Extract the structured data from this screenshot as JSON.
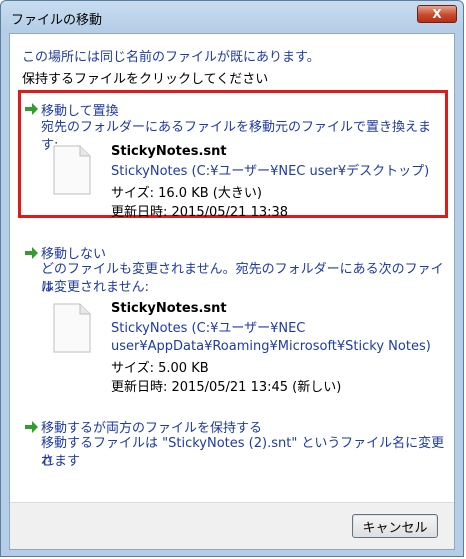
{
  "window": {
    "title": "ファイルの移動",
    "close_label": "X"
  },
  "intro": {
    "line1": "この場所には同じ名前のファイルが既にあります。",
    "line2": "保持するファイルをクリックしてください"
  },
  "options": {
    "replace": {
      "title": "移動して置換",
      "description": "宛先のフォルダーにあるファイルを移動元のファイルで置き換えます:",
      "file": {
        "name": "StickyNotes.snt",
        "path_lines": [
          "StickyNotes (C:¥ユーザー¥NEC user¥デスクトップ)"
        ],
        "size": "サイズ: 16.0 KB (大きい)",
        "modified": "更新日時: 2015/05/21 13:38"
      }
    },
    "dont_move": {
      "title": "移動しない",
      "description_lines": [
        "どのファイルも変更されません。宛先のフォルダーにある次のファイル",
        "は変更されません:"
      ],
      "file": {
        "name": "StickyNotes.snt",
        "path_lines": [
          "StickyNotes (C:¥ユーザー¥NEC",
          "user¥AppData¥Roaming¥Microsoft¥Sticky Notes)"
        ],
        "size": "サイズ: 5.00 KB",
        "modified": "更新日時: 2015/05/21 13:45 (新しい)"
      }
    },
    "keep_both": {
      "title": "移動するが両方のファイルを保持する",
      "description_lines": [
        "移動するファイルは \"StickyNotes (2).snt\" というファイル名に変更さ",
        "れます"
      ]
    }
  },
  "footer": {
    "cancel_label": "キャンセル"
  },
  "colors": {
    "link_blue": "#1e3aa8",
    "highlight_red": "#e01a1a",
    "arrow_green": "#2f9e2f"
  }
}
